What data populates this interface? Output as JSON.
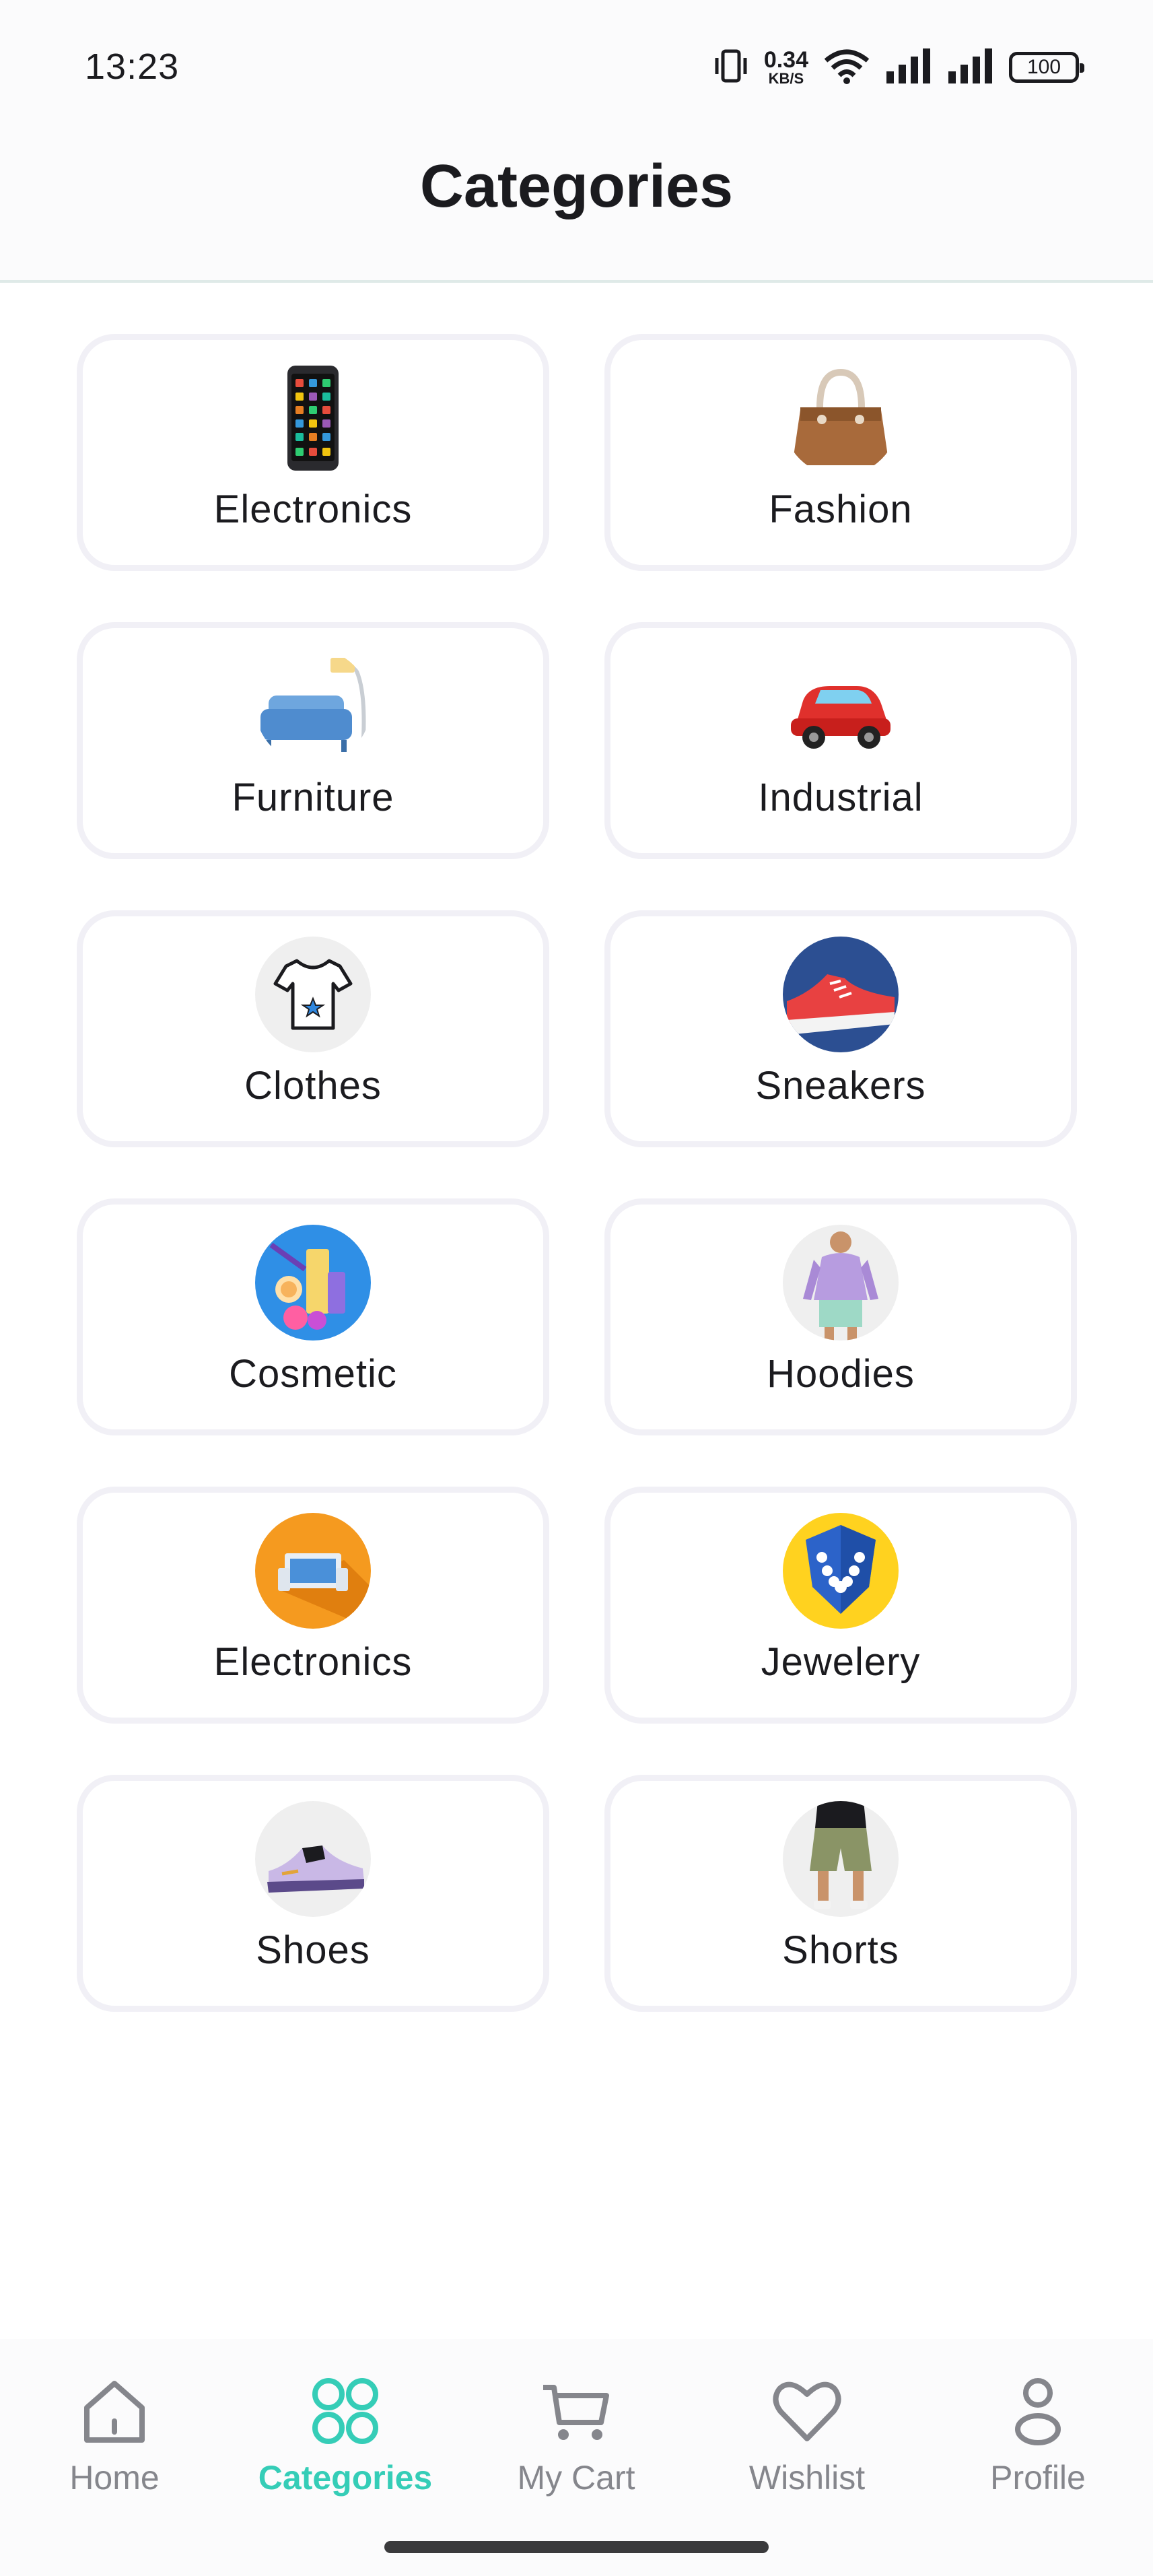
{
  "status_bar": {
    "time": "13:23",
    "net_speed_value": "0.34",
    "net_speed_unit": "KB/S",
    "battery": "100",
    "icons": [
      "vibrate-icon",
      "wifi-icon",
      "signal-icon",
      "signal-icon",
      "battery-icon"
    ]
  },
  "header": {
    "title": "Categories"
  },
  "categories": [
    {
      "label": "Electronics",
      "icon": "smartphone-icon"
    },
    {
      "label": "Fashion",
      "icon": "handbag-icon"
    },
    {
      "label": "Furniture",
      "icon": "sofa-icon"
    },
    {
      "label": "Industrial",
      "icon": "car-icon"
    },
    {
      "label": "Clothes",
      "icon": "tshirt-icon"
    },
    {
      "label": "Sneakers",
      "icon": "sneaker-icon"
    },
    {
      "label": "Cosmetic",
      "icon": "cosmetics-icon"
    },
    {
      "label": "Hoodies",
      "icon": "hoodie-icon"
    },
    {
      "label": "Electronics",
      "icon": "computer-icon"
    },
    {
      "label": "Jewelery",
      "icon": "necklace-icon"
    },
    {
      "label": "Shoes",
      "icon": "shoe-icon"
    },
    {
      "label": "Shorts",
      "icon": "shorts-icon"
    }
  ],
  "bottom_nav": {
    "items": [
      {
        "label": "Home",
        "icon": "home-icon",
        "active": false
      },
      {
        "label": "Categories",
        "icon": "grid-icon",
        "active": true
      },
      {
        "label": "My Cart",
        "icon": "cart-icon",
        "active": false
      },
      {
        "label": "Wishlist",
        "icon": "heart-icon",
        "active": false
      },
      {
        "label": "Profile",
        "icon": "person-icon",
        "active": false
      }
    ]
  },
  "colors": {
    "accent": "#35cdb7",
    "inactive": "#85868c",
    "card_border": "#f1f0f6",
    "text": "#1b1b1f"
  }
}
